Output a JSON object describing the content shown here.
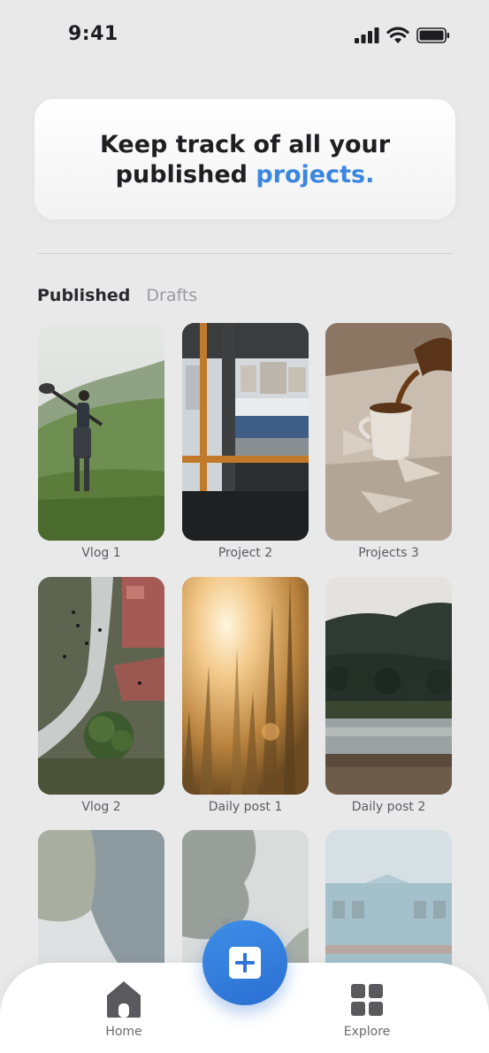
{
  "status_bar": {
    "time": "9:41"
  },
  "hero": {
    "line1": "Keep track of all your",
    "line2_prefix": "published ",
    "line2_accent": "projects.",
    "accent_color": "#3b86e0"
  },
  "tabs": [
    {
      "label": "Published",
      "active": true
    },
    {
      "label": "Drafts",
      "active": false
    }
  ],
  "projects": [
    {
      "title": "Vlog 1",
      "image": "hiker-on-green-hills"
    },
    {
      "title": "Project 2",
      "image": "bus-window-city-view"
    },
    {
      "title": "Projects 3",
      "image": "pouring-coffee-mug"
    },
    {
      "title": "Vlog 2",
      "image": "aerial-park-path"
    },
    {
      "title": "Daily post 1",
      "image": "sunlit-tall-grass"
    },
    {
      "title": "Daily post 2",
      "image": "mountain-lake-shore"
    },
    {
      "title": "",
      "image": "aerial-coastline"
    },
    {
      "title": "",
      "image": "misty-tree"
    },
    {
      "title": "",
      "image": "blue-building-facade"
    }
  ],
  "nav": {
    "home_label": "Home",
    "explore_label": "Explore",
    "fab_icon": "plus-icon",
    "fab_color": "#2f76d8"
  }
}
